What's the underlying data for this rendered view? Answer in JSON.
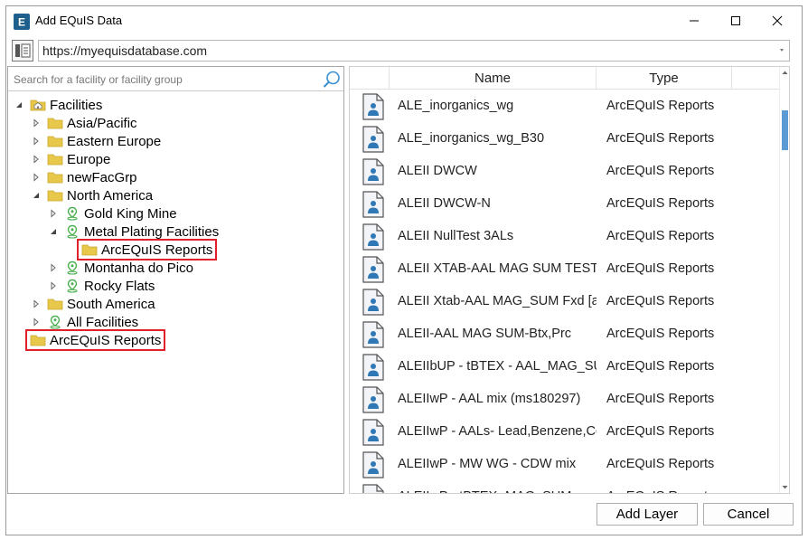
{
  "window": {
    "title": "Add EQuIS Data",
    "app_icon_letter": "E",
    "app_icon_color": "#1f5f8b"
  },
  "urlbar": {
    "value": "https://myequisdatabase.com"
  },
  "search": {
    "placeholder": "Search for a facility or facility group"
  },
  "tree": [
    {
      "label": "Facilities",
      "icon": "home-folder-icon",
      "arrow": "expanded",
      "level": 0
    },
    {
      "label": "Asia/Pacific",
      "icon": "folder-icon",
      "arrow": "collapsed",
      "level": 1
    },
    {
      "label": "Eastern Europe",
      "icon": "folder-icon",
      "arrow": "collapsed",
      "level": 1
    },
    {
      "label": "Europe",
      "icon": "folder-icon",
      "arrow": "collapsed",
      "level": 1
    },
    {
      "label": "newFacGrp",
      "icon": "folder-icon",
      "arrow": "collapsed",
      "level": 1
    },
    {
      "label": "North America",
      "icon": "folder-icon",
      "arrow": "expanded",
      "level": 1
    },
    {
      "label": "Gold King Mine",
      "icon": "location-pin-icon",
      "arrow": "collapsed",
      "level": 2
    },
    {
      "label": "Metal Plating Facilities",
      "icon": "location-pin-icon",
      "arrow": "expanded",
      "level": 2
    },
    {
      "label": "ArcEQuIS Reports",
      "icon": "folder-icon",
      "arrow": "none",
      "level": 3,
      "highlighted": true
    },
    {
      "label": "Montanha do Pico",
      "icon": "location-pin-icon",
      "arrow": "collapsed",
      "level": 2
    },
    {
      "label": "Rocky Flats",
      "icon": "location-pin-icon",
      "arrow": "collapsed",
      "level": 2
    },
    {
      "label": "South America",
      "icon": "folder-icon",
      "arrow": "collapsed",
      "level": 1
    },
    {
      "label": "All Facilities",
      "icon": "location-pin-icon",
      "arrow": "collapsed",
      "level": 1
    },
    {
      "label": "ArcEQuIS Reports",
      "icon": "folder-icon",
      "arrow": "none",
      "level": 0,
      "highlighted": true
    }
  ],
  "grid": {
    "columns": {
      "name": "Name",
      "type": "Type"
    },
    "rows": [
      {
        "name": "ALE_inorganics_wg",
        "type": "ArcEQuIS Reports"
      },
      {
        "name": "ALE_inorganics_wg_B30",
        "type": "ArcEQuIS Reports"
      },
      {
        "name": "ALEII DWCW",
        "type": "ArcEQuIS Reports"
      },
      {
        "name": "ALEII DWCW-N",
        "type": "ArcEQuIS Reports"
      },
      {
        "name": "ALEII NullTest 3ALs",
        "type": "ArcEQuIS Reports"
      },
      {
        "name": "ALEII XTAB-AAL MAG SUM TEST [",
        "type": "ArcEQuIS Reports"
      },
      {
        "name": "ALEII Xtab-AAL MAG_SUM Fxd [a",
        "type": "ArcEQuIS Reports"
      },
      {
        "name": "ALEII-AAL MAG SUM-Btx,Prc",
        "type": "ArcEQuIS Reports"
      },
      {
        "name": "ALEIIbUP - tBTEX - AAL_MAG_SUI",
        "type": "ArcEQuIS Reports"
      },
      {
        "name": "ALEIIwP - AAL mix (ms180297)",
        "type": "ArcEQuIS Reports"
      },
      {
        "name": "ALEIIwP - AALs- Lead,Benzene,Cc",
        "type": "ArcEQuIS Reports"
      },
      {
        "name": "ALEIIwP - MW WG - CDW mix",
        "type": "ArcEQuIS Reports"
      },
      {
        "name": "ALEIIwP - tBTEX- MAG_SUM",
        "type": "ArcEQuIS Reports"
      }
    ]
  },
  "buttons": {
    "add_layer": "Add Layer",
    "cancel": "Cancel"
  },
  "colors": {
    "folder": "#e8c84a",
    "pin": "#4caf50",
    "highlight": "#e0202a",
    "scroll_thumb": "#5b9bd5"
  }
}
